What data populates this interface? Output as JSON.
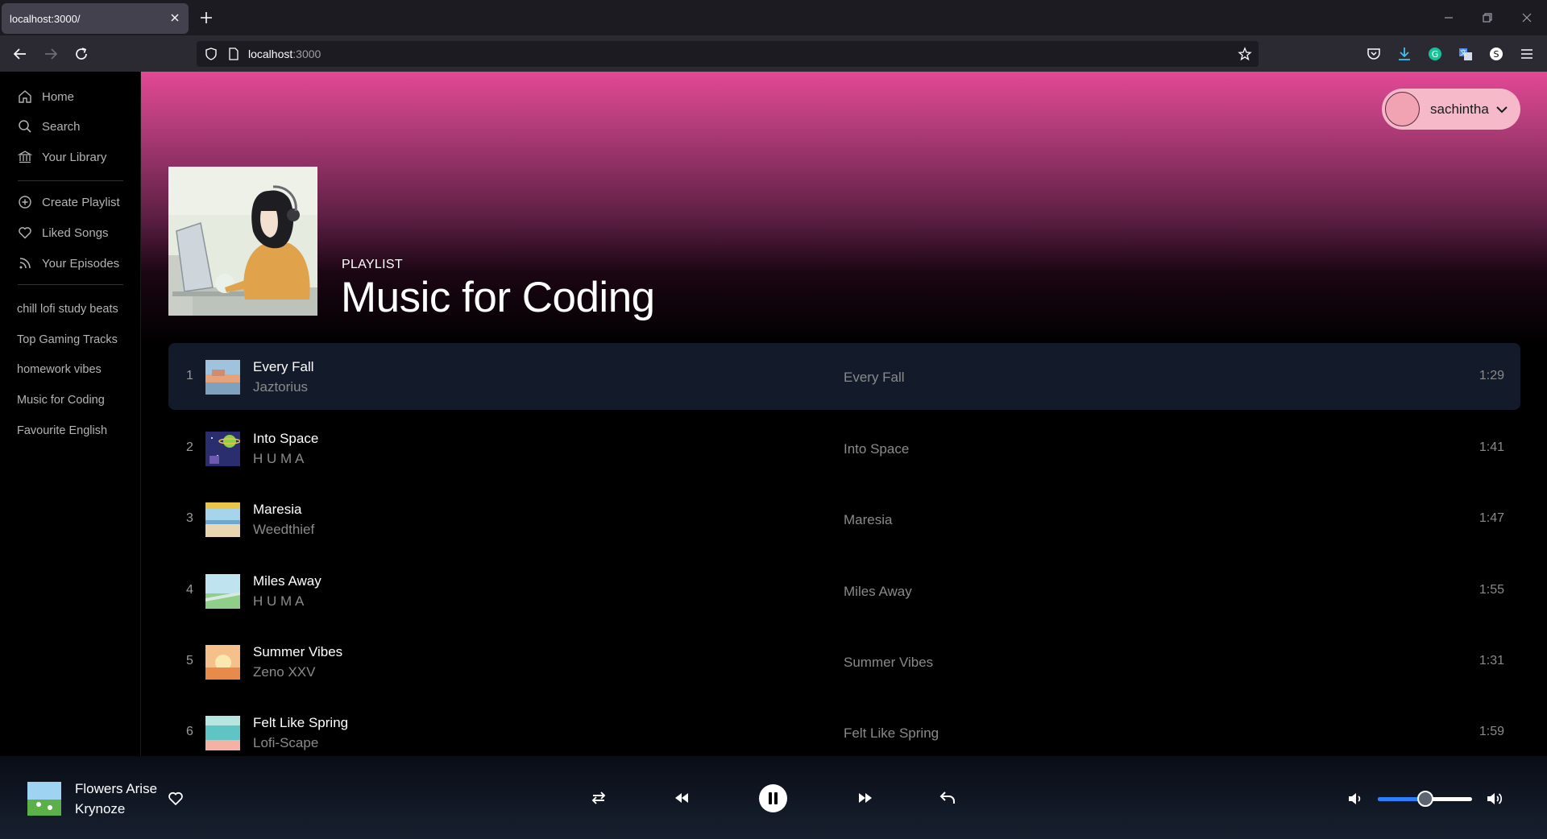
{
  "browser": {
    "tab_title": "localhost:3000/",
    "url_host": "localhost",
    "url_port": ":3000"
  },
  "sidebar": {
    "nav": [
      {
        "label": "Home",
        "icon": "home-icon"
      },
      {
        "label": "Search",
        "icon": "search-icon"
      },
      {
        "label": "Your Library",
        "icon": "library-icon"
      }
    ],
    "actions": [
      {
        "label": "Create Playlist",
        "icon": "plus-circle-icon"
      },
      {
        "label": "Liked Songs",
        "icon": "heart-icon"
      },
      {
        "label": "Your Episodes",
        "icon": "rss-icon"
      }
    ],
    "playlists": [
      "chill lofi study beats",
      "Top Gaming Tracks",
      "homework vibes",
      "Music for Coding",
      "Favourite English"
    ]
  },
  "user": {
    "name": "sachintha"
  },
  "playlist": {
    "type_label": "PLAYLIST",
    "title": "Music for Coding",
    "tracks": [
      {
        "num": "1",
        "title": "Every Fall",
        "artist": "Jaztorius",
        "album": "Every Fall",
        "duration": "1:29"
      },
      {
        "num": "2",
        "title": "Into Space",
        "artist": "H U M A",
        "album": "Into Space",
        "duration": "1:41"
      },
      {
        "num": "3",
        "title": "Maresia",
        "artist": "Weedthief",
        "album": "Maresia",
        "duration": "1:47"
      },
      {
        "num": "4",
        "title": "Miles Away",
        "artist": "H U M A",
        "album": "Miles Away",
        "duration": "1:55"
      },
      {
        "num": "5",
        "title": "Summer Vibes",
        "artist": "Zeno XXV",
        "album": "Summer Vibes",
        "duration": "1:31"
      },
      {
        "num": "6",
        "title": "Felt Like Spring",
        "artist": "Lofi-Scape",
        "album": "Felt Like Spring",
        "duration": "1:59"
      }
    ]
  },
  "player": {
    "title": "Flowers Arise",
    "artist": "Krynoze",
    "volume": 0.5
  },
  "colors": {
    "header_pink": "#e34895",
    "active_row": "#131a2a",
    "volume_blue": "#2d7ff9",
    "user_pill": "#f6b9ca"
  }
}
